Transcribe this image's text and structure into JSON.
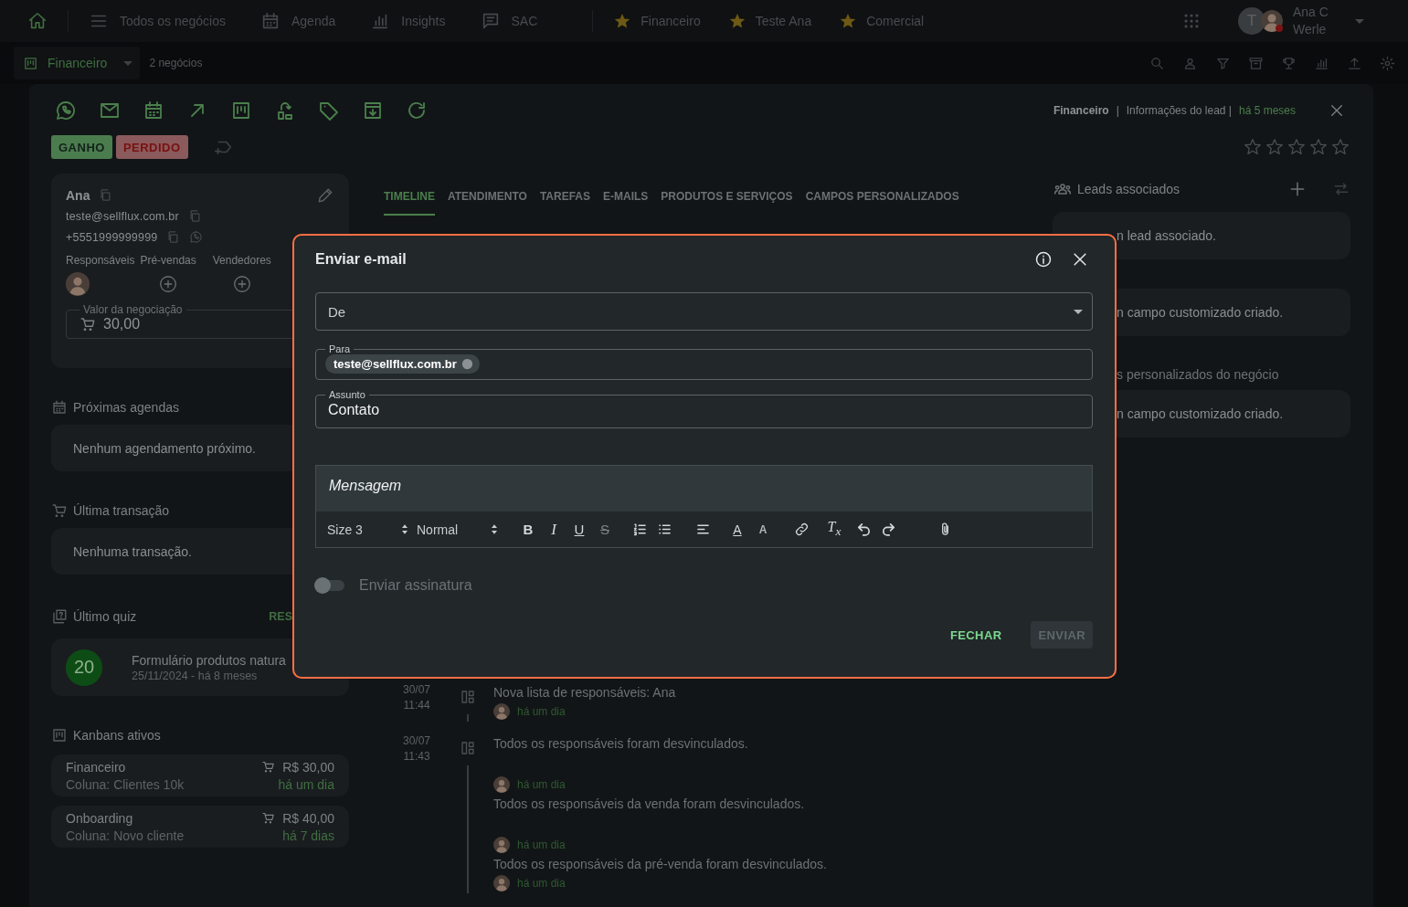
{
  "nav": {
    "items": [
      {
        "kind": "home"
      },
      {
        "kind": "page",
        "label": "Todos os negócios"
      },
      {
        "kind": "page",
        "label": "Agenda"
      },
      {
        "kind": "page",
        "label": "Insights"
      },
      {
        "kind": "page",
        "label": "SAC"
      },
      {
        "kind": "favorite",
        "label": "Financeiro"
      },
      {
        "kind": "favorite",
        "label": "Teste Ana"
      },
      {
        "kind": "favorite",
        "label": "Comercial"
      }
    ],
    "user": {
      "initial": "T",
      "name": "Ana C Werle"
    }
  },
  "board_bar": {
    "board": "Financeiro",
    "count": "2 negócios"
  },
  "lead": {
    "board": "Financeiro",
    "separator": "|",
    "title": "Informações do lead |",
    "age": "há 5 meses",
    "stars": 0,
    "status": [
      {
        "kind": "won",
        "label": "GANHO"
      },
      {
        "kind": "lost",
        "label": "PERDIDO"
      }
    ],
    "contact": {
      "name": "Ana",
      "email": "teste@sellflux.com.br",
      "phone": "+5551999999999",
      "roles": [
        {
          "label": "Responsáveis",
          "assigned": true
        },
        {
          "label": "Pré-vendas",
          "assigned": false
        },
        {
          "label": "Vendedores",
          "assigned": false
        }
      ],
      "value_label": "Valor da negociação",
      "value": "30,00"
    },
    "agenda": {
      "title": "Próximas agendas",
      "empty": "Nenhum agendamento próximo."
    },
    "transaction": {
      "title": "Última transação",
      "empty": "Nenhuma transação."
    },
    "quiz": {
      "title": "Último quiz",
      "action": "RES",
      "score": "20",
      "name": "Formulário produtos natura",
      "date": "25/11/2024 - há 8 meses"
    },
    "kanbans": {
      "title": "Kanbans ativos",
      "items": [
        {
          "name": "Financeiro",
          "column": "Coluna: Clientes 10k",
          "value": "R$ 30,00",
          "age": "há um dia"
        },
        {
          "name": "Onboarding",
          "column": "Coluna: Novo cliente",
          "value": "R$ 40,00",
          "age": "há 7 dias"
        }
      ]
    }
  },
  "tabs": [
    {
      "label": "TIMELINE",
      "selected": true
    },
    {
      "label": "ATENDIMENTO",
      "selected": false
    },
    {
      "label": "TAREFAS",
      "selected": false
    },
    {
      "label": "E-MAILS",
      "selected": false
    },
    {
      "label": "PRODUTOS E SERVIÇOS",
      "selected": false
    },
    {
      "label": "CAMPOS PERSONALIZADOS",
      "selected": false
    }
  ],
  "timeline": [
    {
      "date": "30/07",
      "time": "11:44",
      "lines": [
        {
          "kind": "text",
          "text": "Nova lista de responsáveis: Ana"
        },
        {
          "kind": "meta",
          "text": "há um dia"
        }
      ]
    },
    {
      "date": "30/07",
      "time": "11:43",
      "lines": [
        {
          "kind": "text",
          "text": "Todos os responsáveis foram desvinculados."
        },
        {
          "kind": "meta",
          "text": "há um dia"
        },
        {
          "kind": "text",
          "text": "Todos os responsáveis da venda foram desvinculados."
        },
        {
          "kind": "meta",
          "text": "há um dia"
        },
        {
          "kind": "text",
          "text": "Todos os responsáveis da pré-venda foram desvinculados."
        },
        {
          "kind": "meta",
          "text": "há um dia"
        }
      ]
    }
  ],
  "right": {
    "leads_title": "Leads associados",
    "blocks": [
      {
        "kind": "card",
        "text": "n lead associado."
      },
      {
        "kind": "card",
        "text": "n campo customizado criado."
      },
      {
        "kind": "heading",
        "text": "s personalizados do negócio"
      },
      {
        "kind": "card",
        "text": "n campo customizado criado."
      }
    ]
  },
  "email_dialog": {
    "title": "Enviar e-mail",
    "from": {
      "label": "De"
    },
    "to": {
      "label": "Para",
      "chips": [
        "teste@sellflux.com.br"
      ]
    },
    "subject": {
      "label": "Assunto",
      "value": "Contato"
    },
    "message": {
      "placeholder": "Mensagem"
    },
    "toolbar": [
      {
        "kind": "select",
        "value": "Size 3"
      },
      {
        "kind": "select",
        "value": "Normal"
      },
      {
        "kind": "bold",
        "label": "B"
      },
      {
        "kind": "italic",
        "label": "I"
      },
      {
        "kind": "underline",
        "label": "U"
      },
      {
        "kind": "strike",
        "label": "S"
      },
      {
        "kind": "ordered-list"
      },
      {
        "kind": "bullet-list"
      },
      {
        "kind": "align"
      },
      {
        "kind": "font-color",
        "label": "A"
      },
      {
        "kind": "highlight",
        "label": "A"
      },
      {
        "kind": "link"
      },
      {
        "kind": "clear-format",
        "label": "T$_{x}$"
      },
      {
        "kind": "undo"
      },
      {
        "kind": "redo"
      },
      {
        "kind": "attach"
      }
    ],
    "signature": {
      "label": "Enviar assinatura",
      "on": false
    },
    "actions": [
      {
        "kind": "text",
        "label": "FECHAR",
        "disabled": false
      },
      {
        "kind": "filled",
        "label": "ENVIAR",
        "disabled": true
      }
    ]
  }
}
